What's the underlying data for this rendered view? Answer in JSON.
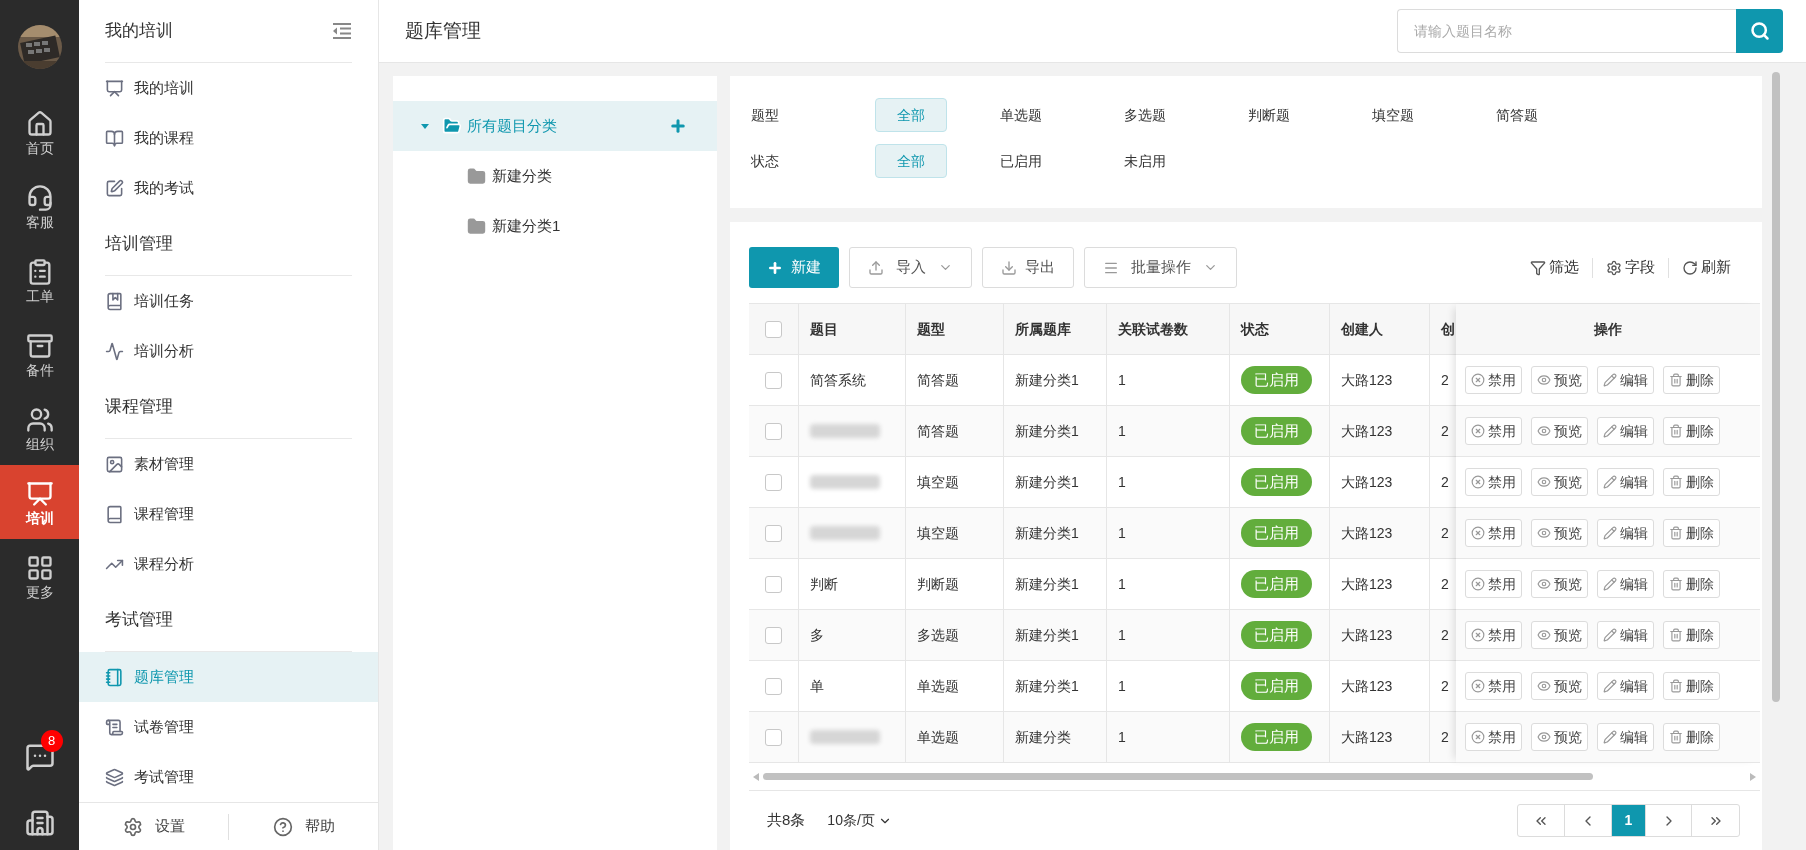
{
  "rail": {
    "items": [
      {
        "label": "首页",
        "selected": false
      },
      {
        "label": "客服",
        "selected": false
      },
      {
        "label": "工单",
        "selected": false
      },
      {
        "label": "备件",
        "selected": false
      },
      {
        "label": "组织",
        "selected": false
      },
      {
        "label": "培训",
        "selected": true
      },
      {
        "label": "更多",
        "selected": false
      }
    ],
    "chat_badge": "8"
  },
  "sidebar": {
    "title": "我的培训",
    "sections": [
      {
        "items": [
          {
            "label": "我的培训",
            "selected": false
          },
          {
            "label": "我的课程",
            "selected": false
          },
          {
            "label": "我的考试",
            "selected": false
          }
        ]
      },
      {
        "title": "培训管理",
        "items": [
          {
            "label": "培训任务",
            "selected": false
          },
          {
            "label": "培训分析",
            "selected": false
          }
        ]
      },
      {
        "title": "课程管理",
        "items": [
          {
            "label": "素材管理",
            "selected": false
          },
          {
            "label": "课程管理",
            "selected": false
          },
          {
            "label": "课程分析",
            "selected": false
          }
        ]
      },
      {
        "title": "考试管理",
        "items": [
          {
            "label": "题库管理",
            "selected": true
          },
          {
            "label": "试卷管理",
            "selected": false
          },
          {
            "label": "考试管理",
            "selected": false
          }
        ]
      }
    ],
    "footer": [
      {
        "label": "设置"
      },
      {
        "label": "帮助"
      }
    ]
  },
  "header": {
    "title": "题库管理",
    "search": {
      "placeholder": "请输入题目名称"
    }
  },
  "tree": {
    "label": "所有题目分类",
    "expanded": true,
    "selected": true,
    "children": [
      {
        "label": "新建分类"
      },
      {
        "label": "新建分类1"
      }
    ]
  },
  "filters": [
    {
      "label": "题型",
      "options": [
        {
          "label": "全部",
          "selected": true
        },
        {
          "label": "单选题",
          "selected": false
        },
        {
          "label": "多选题",
          "selected": false
        },
        {
          "label": "判断题",
          "selected": false
        },
        {
          "label": "填空题",
          "selected": false
        },
        {
          "label": "简答题",
          "selected": false
        }
      ]
    },
    {
      "label": "状态",
      "options": [
        {
          "label": "全部",
          "selected": true
        },
        {
          "label": "已启用",
          "selected": false
        },
        {
          "label": "未启用",
          "selected": false
        }
      ]
    }
  ],
  "toolbar": {
    "buttons": [
      {
        "label": "新建",
        "kind": "primary"
      },
      {
        "label": "导入",
        "kind": "dropdown"
      },
      {
        "label": "导出",
        "kind": "plain"
      },
      {
        "label": "批量操作",
        "kind": "dropdown"
      }
    ],
    "tools": [
      {
        "label": "筛选"
      },
      {
        "label": "字段"
      },
      {
        "label": "刷新"
      }
    ]
  },
  "table": {
    "header_checked": false,
    "columns": [
      "题目",
      "题型",
      "所属题库",
      "关联试卷数",
      "状态",
      "创建人",
      "创",
      "操作"
    ],
    "rows": [
      {
        "checked": false,
        "title": "简答系统",
        "type": "简答题",
        "bank": "新建分类1",
        "papers": "1",
        "status": "已启用",
        "enabled": true,
        "creator": "大路123",
        "created": "2",
        "actions": [
          "禁用",
          "预览",
          "编辑",
          "删除"
        ]
      },
      {
        "checked": false,
        "title_blurred": true,
        "type": "简答题",
        "bank": "新建分类1",
        "papers": "1",
        "status": "已启用",
        "enabled": true,
        "creator": "大路123",
        "created": "2",
        "actions": [
          "禁用",
          "预览",
          "编辑",
          "删除"
        ]
      },
      {
        "checked": false,
        "title_blurred": true,
        "type": "填空题",
        "bank": "新建分类1",
        "papers": "1",
        "status": "已启用",
        "enabled": true,
        "creator": "大路123",
        "created": "2",
        "actions": [
          "禁用",
          "预览",
          "编辑",
          "删除"
        ]
      },
      {
        "checked": false,
        "title_blurred": true,
        "type": "填空题",
        "bank": "新建分类1",
        "papers": "1",
        "status": "已启用",
        "enabled": true,
        "creator": "大路123",
        "created": "2",
        "actions": [
          "禁用",
          "预览",
          "编辑",
          "删除"
        ]
      },
      {
        "checked": false,
        "title": "判断",
        "type": "判断题",
        "bank": "新建分类1",
        "papers": "1",
        "status": "已启用",
        "enabled": true,
        "creator": "大路123",
        "created": "2",
        "actions": [
          "禁用",
          "预览",
          "编辑",
          "删除"
        ]
      },
      {
        "checked": false,
        "title": "多",
        "type": "多选题",
        "bank": "新建分类1",
        "papers": "1",
        "status": "已启用",
        "enabled": true,
        "creator": "大路123",
        "created": "2",
        "actions": [
          "禁用",
          "预览",
          "编辑",
          "删除"
        ]
      },
      {
        "checked": false,
        "title": "单",
        "type": "单选题",
        "bank": "新建分类1",
        "papers": "1",
        "status": "已启用",
        "enabled": true,
        "creator": "大路123",
        "created": "2",
        "actions": [
          "禁用",
          "预览",
          "编辑",
          "删除"
        ]
      },
      {
        "checked": false,
        "title_blurred": true,
        "type": "单选题",
        "bank": "新建分类",
        "papers": "1",
        "status": "已启用",
        "enabled": true,
        "creator": "大路123",
        "created": "2",
        "actions": [
          "禁用",
          "预览",
          "编辑",
          "删除"
        ]
      }
    ]
  },
  "pagination": {
    "total": "共8条",
    "page_size": "10条/页",
    "pages": [
      {
        "label": "1",
        "selected": true
      }
    ]
  }
}
